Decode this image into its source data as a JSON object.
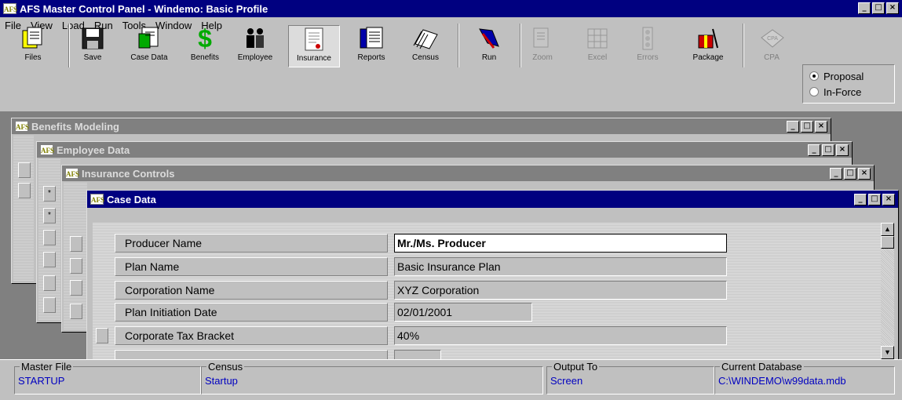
{
  "app": {
    "title": "AFS Master Control Panel - Windemo: Basic Profile",
    "logo": "AFS"
  },
  "menu": [
    "File",
    "View",
    "Load",
    "Run",
    "Tools",
    "Window",
    "Help"
  ],
  "toolbar": {
    "files": "Files",
    "save": "Save",
    "case_data": "Case Data",
    "benefits": "Benefits",
    "employee": "Employee",
    "insurance": "Insurance",
    "reports": "Reports",
    "census": "Census",
    "run": "Run",
    "zoom": "Zoom",
    "excel": "Excel",
    "errors": "Errors",
    "package": "Package",
    "cpa": "CPA"
  },
  "mode": {
    "options": [
      "Proposal",
      "In-Force"
    ],
    "selected": "Proposal"
  },
  "windows": {
    "benefits": "Benefits Modeling",
    "employee": "Employee Data",
    "insurance": "Insurance Controls",
    "case": "Case Data"
  },
  "case_fields": [
    {
      "label": "Producer Name",
      "value": "Mr./Ms. Producer"
    },
    {
      "label": "Plan Name",
      "value": "Basic Insurance Plan"
    },
    {
      "label": "Corporation Name",
      "value": "XYZ Corporation"
    },
    {
      "label": "Plan Initiation Date",
      "value": "02/01/2001"
    },
    {
      "label": "Corporate Tax Bracket",
      "value": "40%"
    }
  ],
  "status": {
    "master_file_label": "Master File",
    "master_file": "STARTUP",
    "census_label": "Census",
    "census": "Startup",
    "output_label": "Output To",
    "output": "Screen",
    "db_label": "Current Database",
    "db": "C:\\WINDEMO\\w99data.mdb"
  },
  "colors": {
    "active_title": "#000080",
    "inactive_title": "#808080",
    "status_value": "#0000c0"
  }
}
